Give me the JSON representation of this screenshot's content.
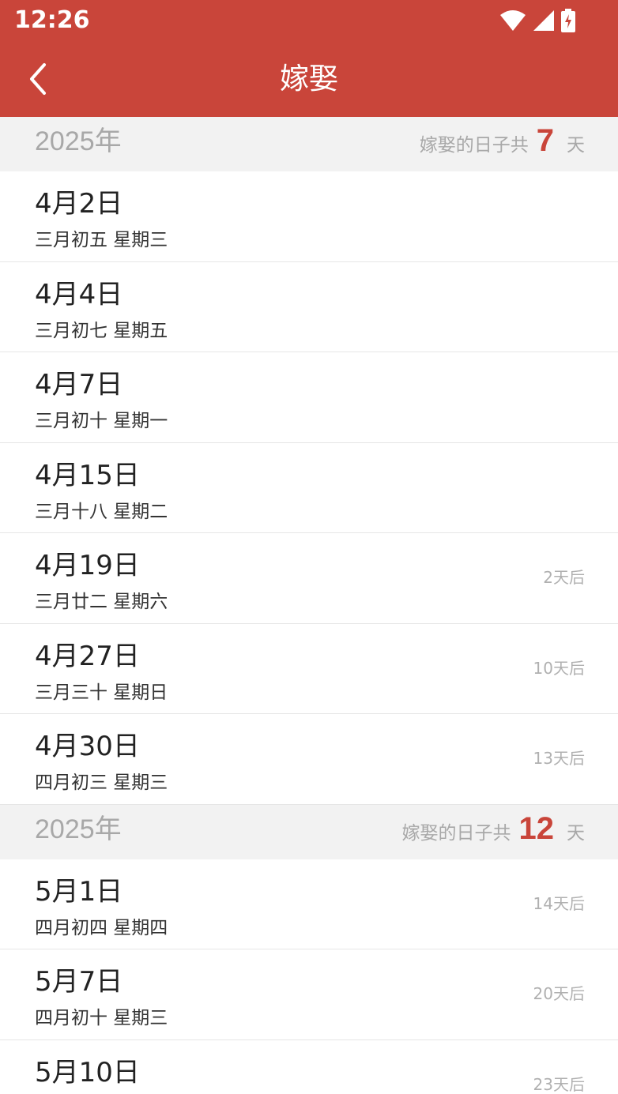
{
  "status_bar": {
    "time": "12:26",
    "icons": [
      "wifi-icon",
      "signal-icon",
      "battery-charging-icon"
    ]
  },
  "header": {
    "title": "嫁娶",
    "back_icon": "chevron-left-icon"
  },
  "colors": {
    "accent": "#C9453A",
    "section_bg": "#F2F2F2",
    "muted_text": "#A8A8A8"
  },
  "sections": [
    {
      "year": "2025年",
      "summary_prefix": "嫁娶的日子共",
      "count": "7",
      "summary_suffix": "天",
      "days": [
        {
          "date": "4月2日",
          "lunar": "三月初五 星期三",
          "countdown": ""
        },
        {
          "date": "4月4日",
          "lunar": "三月初七 星期五",
          "countdown": ""
        },
        {
          "date": "4月7日",
          "lunar": "三月初十 星期一",
          "countdown": ""
        },
        {
          "date": "4月15日",
          "lunar": "三月十八 星期二",
          "countdown": ""
        },
        {
          "date": "4月19日",
          "lunar": "三月廿二 星期六",
          "countdown": "2天后"
        },
        {
          "date": "4月27日",
          "lunar": "三月三十 星期日",
          "countdown": "10天后"
        },
        {
          "date": "4月30日",
          "lunar": "四月初三 星期三",
          "countdown": "13天后"
        }
      ]
    },
    {
      "year": "2025年",
      "summary_prefix": "嫁娶的日子共",
      "count": "12",
      "summary_suffix": "天",
      "days": [
        {
          "date": "5月1日",
          "lunar": "四月初四 星期四",
          "countdown": "14天后"
        },
        {
          "date": "5月7日",
          "lunar": "四月初十 星期三",
          "countdown": "20天后"
        },
        {
          "date": "5月10日",
          "lunar": "",
          "countdown": "23天后"
        }
      ]
    }
  ]
}
